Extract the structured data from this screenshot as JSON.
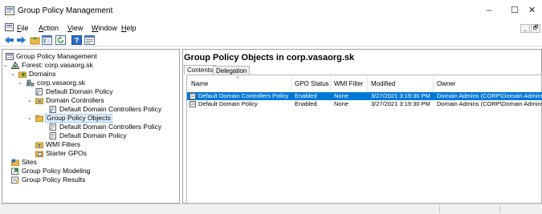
{
  "window": {
    "title": "Group Policy Management",
    "minimize": "–",
    "maximize": "☐",
    "close": "✕"
  },
  "menu": {
    "items": [
      {
        "underline": "F",
        "rest": "ile"
      },
      {
        "underline": "A",
        "rest": "ction"
      },
      {
        "underline": "V",
        "rest": "iew"
      },
      {
        "underline": "W",
        "rest": "indow"
      },
      {
        "underline": "H",
        "rest": "elp"
      }
    ],
    "mdi_minimize": "_",
    "mdi_restore": "🗗"
  },
  "tree": {
    "root": "Group Policy Management",
    "forest": "Forest: corp.vasaorg.sk",
    "domains": "Domains",
    "domain": "corp.vasaorg.sk",
    "default_domain_policy": "Default Domain Policy",
    "domain_controllers": "Domain Controllers",
    "default_dc_policy": "Default Domain Controllers Policy",
    "gpo": "Group Policy Objects",
    "gpo_dc_policy": "Default Domain Controllers Policy",
    "gpo_domain_policy": "Default Domain Policy",
    "wmi_filters": "WMI Filters",
    "starter_gpos": "Starter GPOs",
    "sites": "Sites",
    "modeling": "Group Policy Modeling",
    "results": "Group Policy Results"
  },
  "details": {
    "header": "Group Policy Objects in corp.vasaorg.sk",
    "tabs": [
      "Contents",
      "Delegation"
    ],
    "columns": [
      "Name",
      "GPO Status",
      "WMI Filter",
      "Modified",
      "Owner"
    ],
    "rows": [
      {
        "name": "Default Domain Controllers Policy",
        "status": "Enabled",
        "wmi": "None",
        "modified": "3/27/2021 3:19:30 PM",
        "owner": "Domain Admins (CORP\\Domain Admins)"
      },
      {
        "name": "Default Domain Policy",
        "status": "Enabled",
        "wmi": "None",
        "modified": "3/27/2021 3:19:30 PM",
        "owner": "Domain Admins (CORP\\Domain Admins)"
      }
    ]
  },
  "colors": {
    "selection": "#0078d7",
    "tree_selection": "#e5f1fb",
    "folder": "#e8b84a"
  }
}
